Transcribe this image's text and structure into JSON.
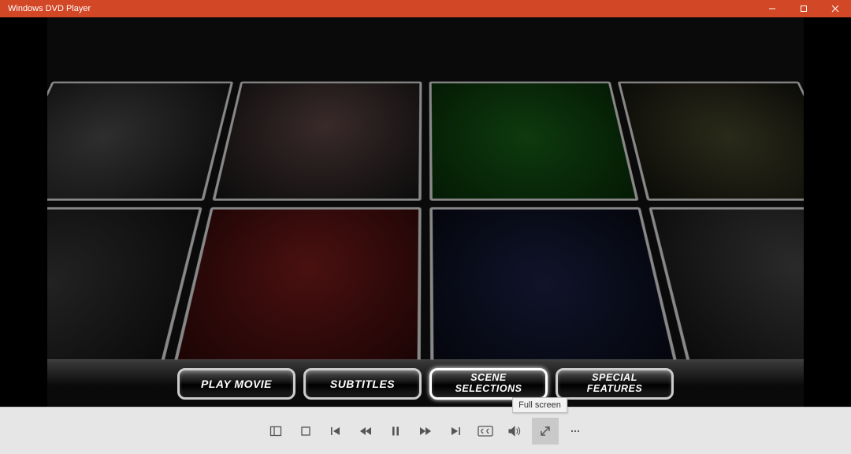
{
  "window": {
    "title": "Windows DVD Player"
  },
  "dvdMenu": {
    "play": "PLAY MOVIE",
    "subtitles": "SUBTITLES",
    "scene": "SCENE\nSELECTIONS",
    "special": "SPECIAL\nFEATURES"
  },
  "controls": {
    "tooltip": "Full screen"
  }
}
